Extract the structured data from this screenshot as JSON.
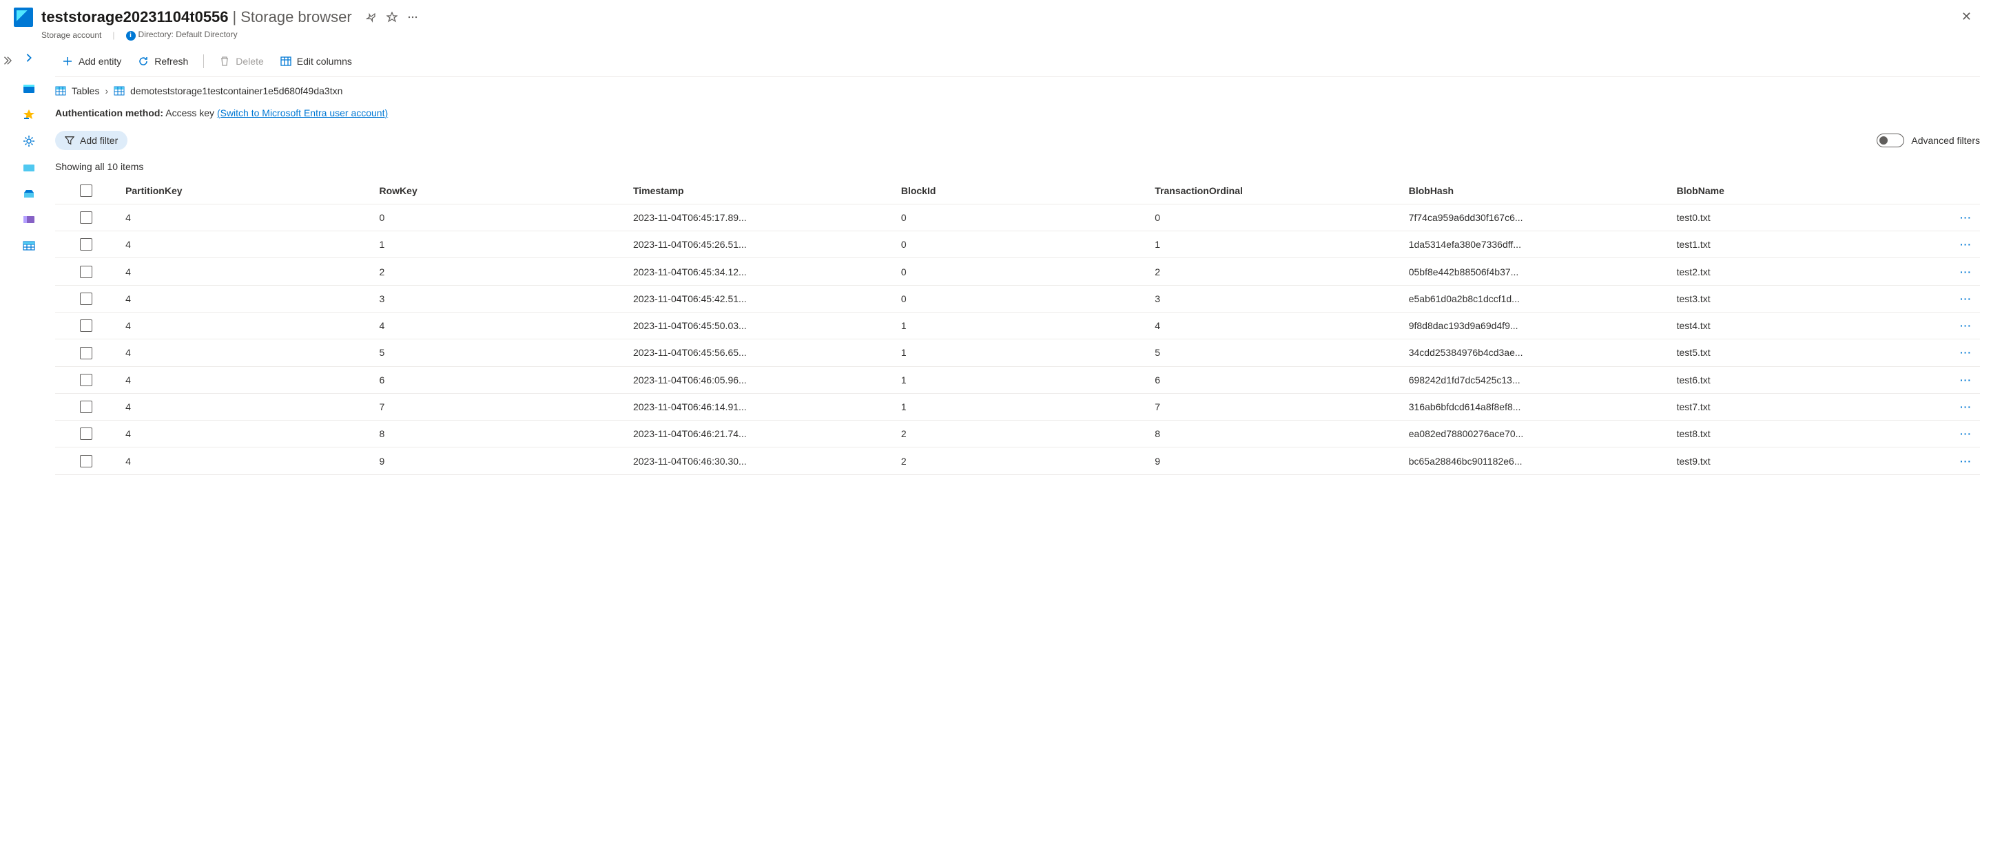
{
  "header": {
    "storage_name": "teststorage20231104t0556",
    "section": "Storage browser",
    "subtitle": "Storage account",
    "directory_label": "Directory: Default Directory"
  },
  "toolbar": {
    "add_entity": "Add entity",
    "refresh": "Refresh",
    "delete": "Delete",
    "edit_columns": "Edit columns"
  },
  "breadcrumb": {
    "root": "Tables",
    "current": "demoteststorage1testcontainer1e5d680f49da3txn"
  },
  "auth": {
    "label": "Authentication method:",
    "method": "Access key",
    "switch_link": "(Switch to Microsoft Entra user account)"
  },
  "filter": {
    "add_filter": "Add filter",
    "advanced": "Advanced filters"
  },
  "count_text": "Showing all 10 items",
  "columns": [
    "PartitionKey",
    "RowKey",
    "Timestamp",
    "BlockId",
    "TransactionOrdinal",
    "BlobHash",
    "BlobName"
  ],
  "rows": [
    {
      "pk": "4",
      "rk": "0",
      "ts": "2023-11-04T06:45:17.89...",
      "bid": "0",
      "to": "0",
      "bh": "7f74ca959a6dd30f167c6...",
      "bn": "test0.txt"
    },
    {
      "pk": "4",
      "rk": "1",
      "ts": "2023-11-04T06:45:26.51...",
      "bid": "0",
      "to": "1",
      "bh": "1da5314efa380e7336dff...",
      "bn": "test1.txt"
    },
    {
      "pk": "4",
      "rk": "2",
      "ts": "2023-11-04T06:45:34.12...",
      "bid": "0",
      "to": "2",
      "bh": "05bf8e442b88506f4b37...",
      "bn": "test2.txt"
    },
    {
      "pk": "4",
      "rk": "3",
      "ts": "2023-11-04T06:45:42.51...",
      "bid": "0",
      "to": "3",
      "bh": "e5ab61d0a2b8c1dccf1d...",
      "bn": "test3.txt"
    },
    {
      "pk": "4",
      "rk": "4",
      "ts": "2023-11-04T06:45:50.03...",
      "bid": "1",
      "to": "4",
      "bh": "9f8d8dac193d9a69d4f9...",
      "bn": "test4.txt"
    },
    {
      "pk": "4",
      "rk": "5",
      "ts": "2023-11-04T06:45:56.65...",
      "bid": "1",
      "to": "5",
      "bh": "34cdd25384976b4cd3ae...",
      "bn": "test5.txt"
    },
    {
      "pk": "4",
      "rk": "6",
      "ts": "2023-11-04T06:46:05.96...",
      "bid": "1",
      "to": "6",
      "bh": "698242d1fd7dc5425c13...",
      "bn": "test6.txt"
    },
    {
      "pk": "4",
      "rk": "7",
      "ts": "2023-11-04T06:46:14.91...",
      "bid": "1",
      "to": "7",
      "bh": "316ab6bfdcd614a8f8ef8...",
      "bn": "test7.txt"
    },
    {
      "pk": "4",
      "rk": "8",
      "ts": "2023-11-04T06:46:21.74...",
      "bid": "2",
      "to": "8",
      "bh": "ea082ed78800276ace70...",
      "bn": "test8.txt"
    },
    {
      "pk": "4",
      "rk": "9",
      "ts": "2023-11-04T06:46:30.30...",
      "bid": "2",
      "to": "9",
      "bh": "bc65a28846bc901182e6...",
      "bn": "test9.txt"
    }
  ]
}
